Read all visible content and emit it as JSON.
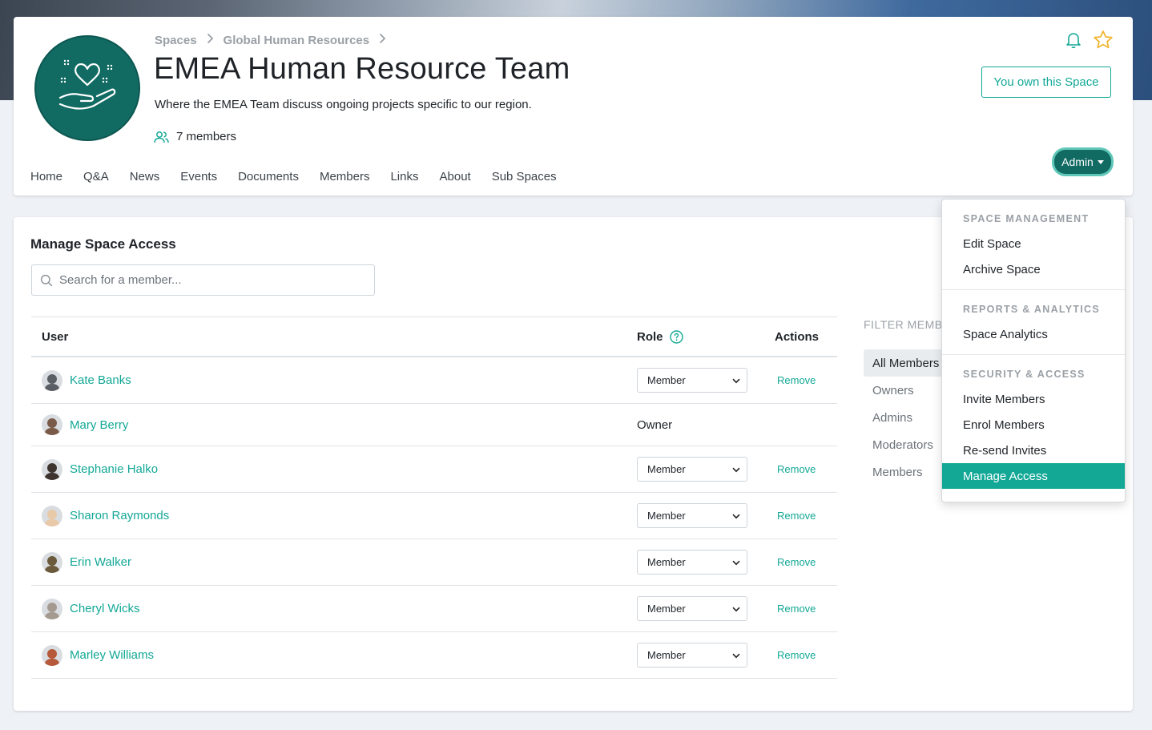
{
  "breadcrumb": [
    "Spaces",
    "Global Human Resources"
  ],
  "space": {
    "title": "EMEA Human Resource Team",
    "description": "Where the EMEA Team discuss ongoing projects specific to our region.",
    "members_label": "7 members",
    "own_label": "You own this Space"
  },
  "tabs": [
    "Home",
    "Q&A",
    "News",
    "Events",
    "Documents",
    "Members",
    "Links",
    "About",
    "Sub Spaces"
  ],
  "admin_label": "Admin",
  "manage": {
    "title": "Manage Space Access",
    "search_placeholder": "Search for a member...",
    "col_user": "User",
    "col_role": "Role",
    "col_actions": "Actions",
    "remove_label": "Remove"
  },
  "members": [
    {
      "name": "Kate Banks",
      "role": "Member",
      "editable": true,
      "avatar_color": "#5a5f66"
    },
    {
      "name": "Mary Berry",
      "role": "Owner",
      "editable": false,
      "avatar_color": "#7a5a48"
    },
    {
      "name": "Stephanie Halko",
      "role": "Member",
      "editable": true,
      "avatar_color": "#3e342f"
    },
    {
      "name": "Sharon Raymonds",
      "role": "Member",
      "editable": true,
      "avatar_color": "#e8c9a8"
    },
    {
      "name": "Erin Walker",
      "role": "Member",
      "editable": true,
      "avatar_color": "#6b5a3c"
    },
    {
      "name": "Cheryl Wicks",
      "role": "Member",
      "editable": true,
      "avatar_color": "#a59a90"
    },
    {
      "name": "Marley Williams",
      "role": "Member",
      "editable": true,
      "avatar_color": "#b5593a"
    }
  ],
  "filter": {
    "label": "FILTER MEMBERS",
    "items": [
      "All Members",
      "Owners",
      "Admins",
      "Moderators",
      "Members"
    ]
  },
  "dropdown": {
    "sections": [
      {
        "header": "SPACE MANAGEMENT",
        "items": [
          "Edit Space",
          "Archive Space"
        ]
      },
      {
        "header": "REPORTS & ANALYTICS",
        "items": [
          "Space Analytics"
        ]
      },
      {
        "header": "SECURITY & ACCESS",
        "items": [
          "Invite Members",
          "Enrol Members",
          "Re-send Invites",
          "Manage Access"
        ]
      }
    ],
    "active_item": "Manage Access"
  },
  "colors": {
    "accent": "#13a896",
    "brand_dark": "#116b63"
  }
}
